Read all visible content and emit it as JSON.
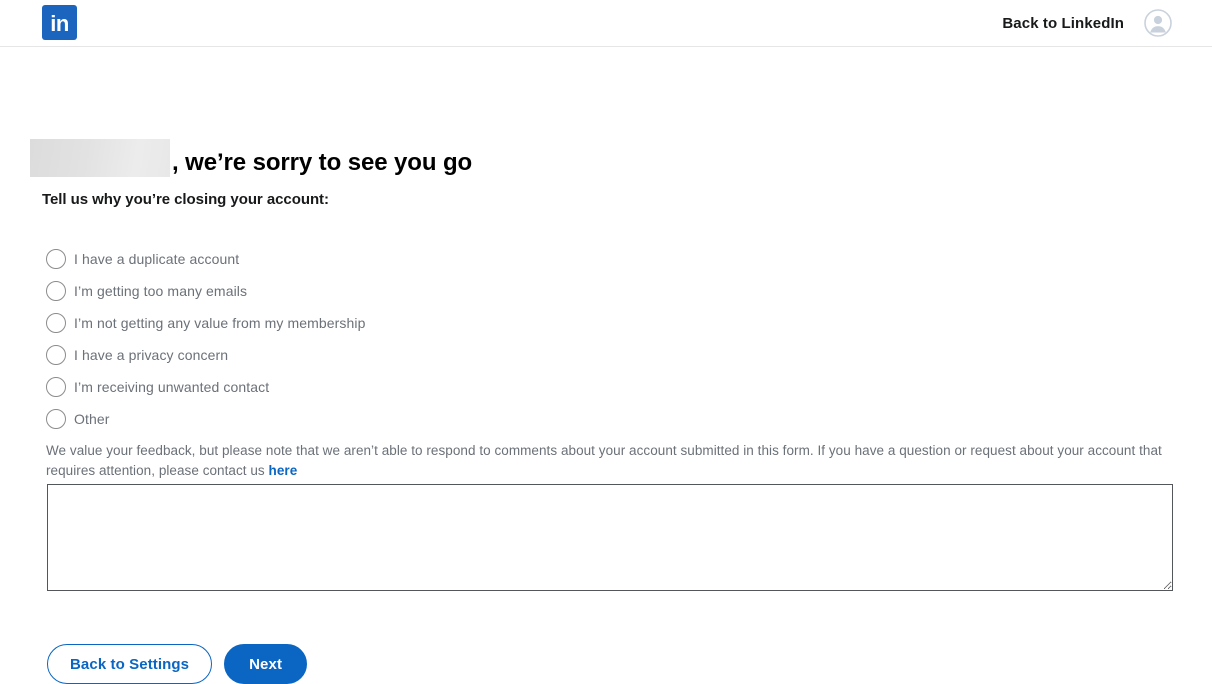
{
  "nav": {
    "logo_text": "in",
    "logo_name": "linkedin-logo",
    "back_link": "Back to LinkedIn",
    "avatar_icon": "user-avatar-icon"
  },
  "page": {
    "redacted_name": "",
    "headline": ", we’re sorry to see you go",
    "subhead": "Tell us why you’re closing your account:"
  },
  "reasons": [
    {
      "id": "duplicate-account",
      "label": "I have a duplicate account",
      "selected": false
    },
    {
      "id": "too-many-emails",
      "label": "I’m getting too many emails",
      "selected": false
    },
    {
      "id": "no-value",
      "label": "I’m not getting any value from my membership",
      "selected": false
    },
    {
      "id": "privacy-concern",
      "label": "I have a privacy concern",
      "selected": false
    },
    {
      "id": "unwanted-contact",
      "label": "I’m receiving unwanted contact",
      "selected": false
    },
    {
      "id": "other",
      "label": "Other",
      "selected": false
    }
  ],
  "disclaimer": {
    "text": "We value your feedback, but please note that we aren’t able to respond to comments about your account submitted in this form. If you have a question or request about your account that requires attention, please contact us ",
    "link_label": "here"
  },
  "feedback": {
    "value": "",
    "placeholder": ""
  },
  "buttons": {
    "back_label": "Back to Settings",
    "next_label": "Next"
  },
  "colors": {
    "brand_blue": "#0a66c2",
    "logo_blue": "#1b65bf",
    "label_gray": "#6b7178",
    "border_gray": "#e6e6e6"
  }
}
